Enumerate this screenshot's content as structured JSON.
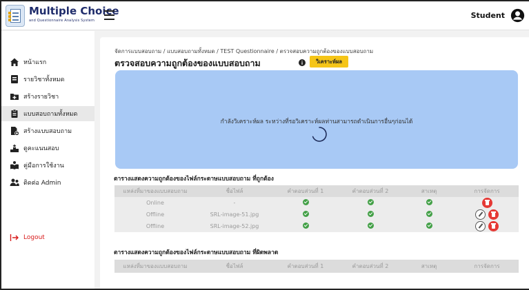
{
  "header": {
    "app_title": "Multiple Choice",
    "app_subtitle": "and Questionnaire Analysis System",
    "user_name": "Student"
  },
  "sidebar": {
    "items": [
      {
        "label": "หน้าแรก",
        "icon": "home-icon"
      },
      {
        "label": "รายวิชาทั้งหมด",
        "icon": "book-icon"
      },
      {
        "label": "สร้างรายวิชา",
        "icon": "add-folder-icon"
      },
      {
        "label": "แบบสอบถามทั้งหมด",
        "icon": "clipboard-icon"
      },
      {
        "label": "สร้างแบบสอบถาม",
        "icon": "create-document-icon"
      },
      {
        "label": "ดูคะแนนสอบ",
        "icon": "podium-icon"
      },
      {
        "label": "คู่มือการใช้งาน",
        "icon": "manual-icon"
      },
      {
        "label": "ติดต่อ Admin",
        "icon": "contact-icon"
      }
    ],
    "active_index": 3,
    "logout_label": "Logout"
  },
  "main": {
    "breadcrumb": "จัดการแบบสอบถาม / แบบสอบถามทั้งหมด / TEST Questionnaire / ตรวจสอบความถูกต้องของแบบสอบถาม",
    "title": "ตรวจสอบความถูกต้องของแบบสอบถาม",
    "analyze_button": "วิเคราะห์ผล",
    "progress_message": "กำลังวิเคราะห์ผล ระหว่างที่รอวิเคราะห์ผลท่านสามารถดำเนินการอื่นๆก่อนได้",
    "correct_table": {
      "title": "ตารางแสดงความถูกต้องของไฟล์กระดาษแบบสอบถาม ที่ถูกต้อง",
      "headers": [
        "แหล่งที่มาของแบบสอบถาม",
        "ชื่อไฟล์",
        "คำตอบส่วนที่ 1",
        "คำตอบส่วนที่ 2",
        "สาเหตุ",
        "การจัดการ"
      ],
      "rows": [
        {
          "source": "Online",
          "filename": "-",
          "part1": "ok",
          "part2": "ok",
          "cause": "ok",
          "actions": [
            "delete"
          ]
        },
        {
          "source": "Offline",
          "filename": "SRL-image-51.jpg",
          "part1": "ok",
          "part2": "ok",
          "cause": "ok",
          "actions": [
            "edit",
            "delete"
          ]
        },
        {
          "source": "Offline",
          "filename": "SRL-image-52.jpg",
          "part1": "ok",
          "part2": "ok",
          "cause": "ok",
          "actions": [
            "edit",
            "delete"
          ]
        }
      ]
    },
    "error_table": {
      "title": "ตารางแสดงความถูกต้องของไฟล์กระดาษแบบสอบถาม ที่ผิดพลาด",
      "headers": [
        "แหล่งที่มาของแบบสอบถาม",
        "ชื่อไฟล์",
        "คำตอบส่วนที่ 1",
        "คำตอบส่วนที่ 2",
        "สาเหตุ",
        "การจัดการ"
      ],
      "rows": []
    }
  },
  "colors": {
    "accent_yellow": "#f5c518",
    "panel_blue": "#a8c9f5",
    "ok_green": "#43a047",
    "delete_red": "#e53935",
    "logout_red": "#d81b1b",
    "brand_navy": "#1f2c6b"
  }
}
